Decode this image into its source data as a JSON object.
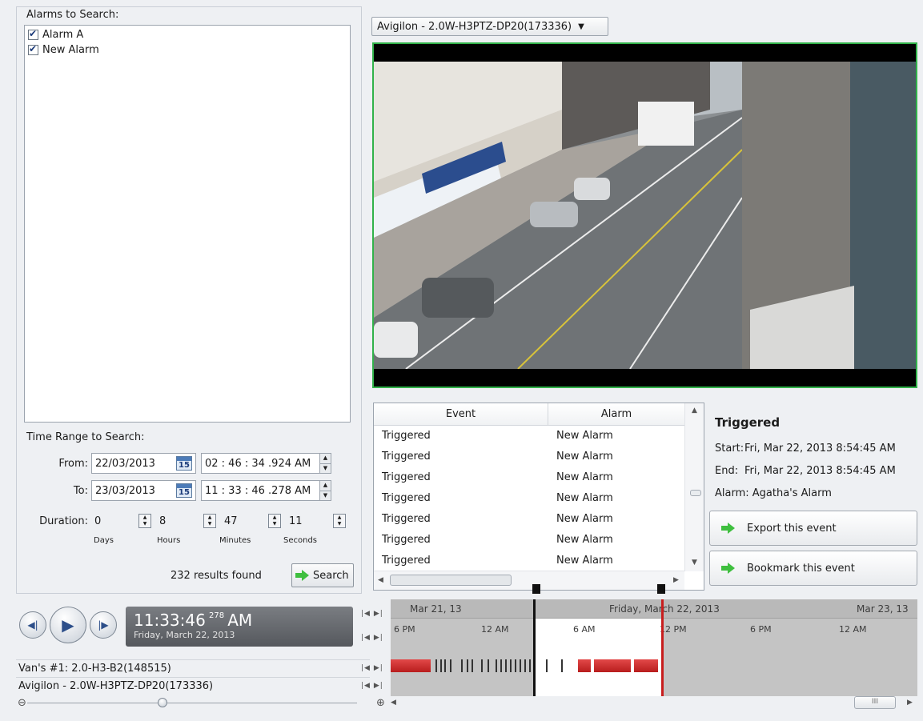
{
  "search": {
    "alarms_title": "Alarms to Search:",
    "alarms": [
      {
        "label": "Alarm A",
        "checked": true
      },
      {
        "label": "New Alarm",
        "checked": true
      }
    ],
    "time_range_title": "Time Range to Search:",
    "from_label": "From:",
    "from_date": "22/03/2013",
    "from_time": "02 : 46 : 34 .924  AM",
    "to_label": "To:",
    "to_date": "23/03/2013",
    "to_time": "11 : 33 : 46 .278  AM",
    "calendar_icon_text": "15",
    "duration_label": "Duration:",
    "duration": {
      "days": "0",
      "hours": "8",
      "minutes": "47",
      "seconds": "11"
    },
    "duration_units": {
      "days": "Days",
      "hours": "Hours",
      "minutes": "Minutes",
      "seconds": "Seconds"
    },
    "results_text": "232  results found",
    "search_button": "Search"
  },
  "camera_dropdown": {
    "selected": "Avigilon - 2.0W-H3PTZ-DP20(173336)"
  },
  "events_table": {
    "columns": [
      "Event",
      "Alarm"
    ],
    "rows": [
      [
        "Triggered",
        "New Alarm"
      ],
      [
        "Triggered",
        "New Alarm"
      ],
      [
        "Triggered",
        "New Alarm"
      ],
      [
        "Triggered",
        "New Alarm"
      ],
      [
        "Triggered",
        "New Alarm"
      ],
      [
        "Triggered",
        "New Alarm"
      ],
      [
        "Triggered",
        "New Alarm"
      ]
    ]
  },
  "event_detail": {
    "title": "Triggered",
    "start_label": "Start:",
    "start_value": "Fri, Mar 22, 2013 8:54:45 AM",
    "end_label": "End:",
    "end_value": "Fri, Mar 22, 2013 8:54:45 AM",
    "alarm_line": "Alarm: Agatha's Alarm",
    "export_button": "Export this event",
    "bookmark_button": "Bookmark this event"
  },
  "player": {
    "time": "11:33:46",
    "ms": "278",
    "ampm": "AM",
    "date": "Friday, March 22, 2013"
  },
  "cameras": [
    "Van's #1: 2.0-H3-B2(148515)",
    "Avigilon - 2.0W-H3PTZ-DP20(173336)"
  ],
  "timeline": {
    "dates": [
      "Mar 21, 13",
      "Friday, March 22, 2013",
      "Mar 23, 13"
    ],
    "ticks": [
      "6 PM",
      "12 AM",
      "6 AM",
      "12 PM",
      "6 PM",
      "12 AM"
    ],
    "colors": {
      "recording": "#d32a2a",
      "selection": "#ffffff",
      "start_marker": "#111111",
      "end_marker": "#c81e1e",
      "video_border": "#31b24a",
      "search_arrow": "#3fbf3f"
    }
  },
  "scrollbar_thumb_text": "III"
}
